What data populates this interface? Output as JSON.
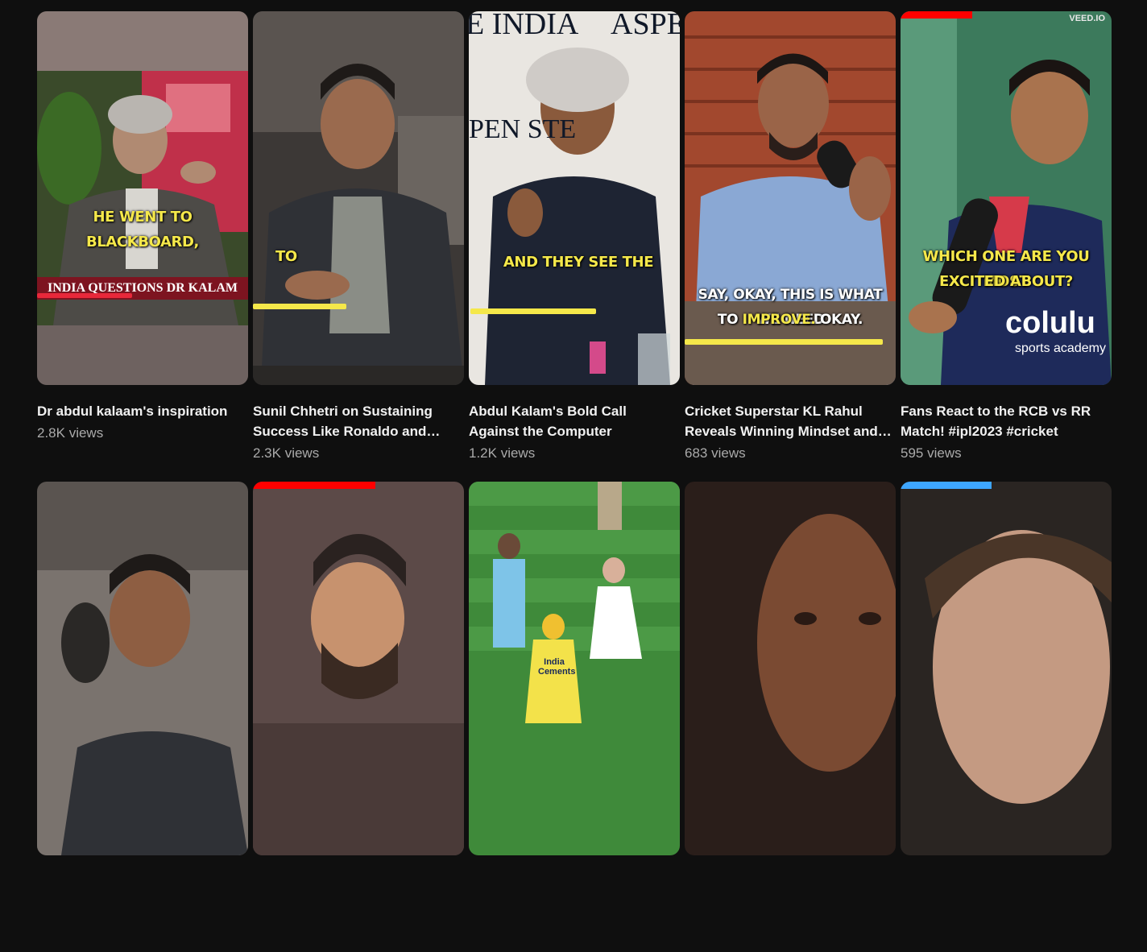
{
  "videos": [
    {
      "title": "Dr abdul kalaam's inspiration",
      "views": "2.8K views",
      "caption": "HE WENT TO BLACKBOARD,",
      "lower_third": "INDIA QUESTIONS DR KALAM",
      "progress_pct": 0,
      "progress_color": "#ff0000"
    },
    {
      "title": "Sunil Chhetri on Sustaining Success Like Ronaldo and Messi",
      "views": "2.3K views",
      "caption": "TO",
      "progress_pct": 0,
      "progress_color": "#ff0000"
    },
    {
      "title": "Abdul Kalam's Bold Call Against the Computer",
      "views": "1.2K views",
      "caption": "AND THEY SEE THE",
      "sign_left": "E INDIA",
      "sign_right": "ASPE",
      "sign_mid": "PEN    STE",
      "progress_pct": 0,
      "progress_color": "#ff0000"
    },
    {
      "title": "Cricket Superstar KL Rahul Reveals Winning Mindset and Mental Strength",
      "views": "683 views",
      "caption_line1": "SAY, OKAY, THIS IS WHAT WE NEED",
      "caption_line2_a": "TO ",
      "caption_line2_b": "IMPROVE.",
      "caption_line2_c": " OKAY.",
      "progress_pct": 0,
      "progress_color": "#ff0000"
    },
    {
      "title": "Fans React to the RCB vs RR Match! #ipl2023 #cricket",
      "views": "595 views",
      "caption_line1": "WHICH ONE ARE YOU MOST",
      "caption_line2": "EXCITED ABOUT?",
      "watermark": "VEED.IO",
      "jersey_brand": "colulu",
      "jersey_sub": "sports academy",
      "progress_pct": 34,
      "progress_color": "#ff0000"
    },
    {
      "progress_pct": 0,
      "progress_color": "#ff0000"
    },
    {
      "progress_pct": 58,
      "progress_color": "#ff0000"
    },
    {
      "jersey_text": "India Cements",
      "progress_pct": 0,
      "progress_color": "#ff0000"
    },
    {
      "progress_pct": 0,
      "progress_color": "#ff0000"
    },
    {
      "progress_pct": 43,
      "progress_color": "#3ea6ff"
    }
  ],
  "colors": {
    "background": "#0f0f0f",
    "title": "#f1f1f1",
    "meta": "#aaaaaa",
    "caption": "#f5e84a"
  }
}
